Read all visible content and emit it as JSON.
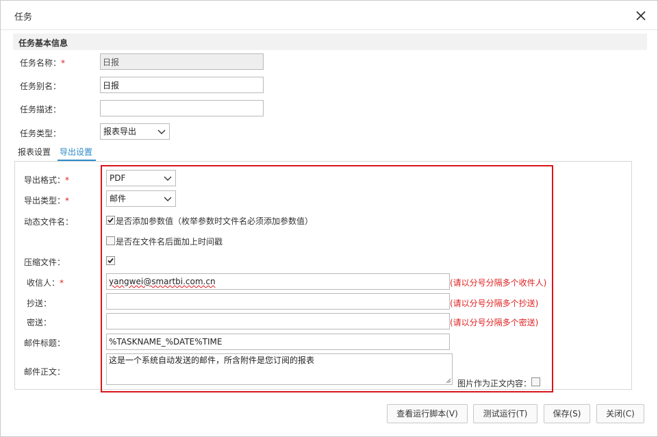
{
  "dialog": {
    "title": "任务",
    "close_icon": "close-icon"
  },
  "basic_info": {
    "section_title": "任务基本信息",
    "task_name": {
      "label": "任务名称：",
      "required": "*",
      "value": "日报"
    },
    "task_alias": {
      "label": "任务别名：",
      "value": "日报"
    },
    "task_desc": {
      "label": "任务描述：",
      "value": ""
    },
    "task_type": {
      "label": "任务类型：",
      "value": "报表导出"
    }
  },
  "tabs": [
    {
      "label": "报表设置",
      "active": false
    },
    {
      "label": "导出设置",
      "active": true
    }
  ],
  "export": {
    "format": {
      "label": "导出格式：",
      "required": "*",
      "value": "PDF"
    },
    "export_type": {
      "label": "导出类型：",
      "required": "*",
      "value": "邮件"
    },
    "dynamic_filename": {
      "label": "动态文件名：",
      "opt_add_param": {
        "text": "是否添加参数值（枚举参数时文件名必须添加参数值）",
        "checked": true
      },
      "opt_timestamp": {
        "text": "是否在文件名后面加上时间戳",
        "checked": false
      }
    },
    "compress": {
      "label": "压缩文件：",
      "checked": true
    },
    "recipient": {
      "label": "收信人：",
      "required": "*",
      "value": "yangwei@smartbi.com.cn",
      "hint": "(请以分号分隔多个收件人)"
    },
    "cc": {
      "label": "抄送：",
      "value": "",
      "hint": "(请以分号分隔多个抄送)"
    },
    "bcc": {
      "label": "密送：",
      "value": "",
      "hint": "(请以分号分隔多个密送)"
    },
    "mail_subject": {
      "label": "邮件标题：",
      "value": "%TASKNAME_%DATE%TIME"
    },
    "mail_body": {
      "label": "邮件正文：",
      "value": "这是一个系统自动发送的邮件，所含附件是您订阅的报表"
    },
    "image_as_body": {
      "label": "图片作为正文内容：",
      "checked": false
    }
  },
  "footer": {
    "view_script": "查看运行脚本(V)",
    "test_run": "测试运行(T)",
    "save": "保存(S)",
    "close": "关闭(C)"
  },
  "colors": {
    "accent": "#2b8ac9",
    "required": "#e02020",
    "highlight_border": "#d9141b"
  }
}
